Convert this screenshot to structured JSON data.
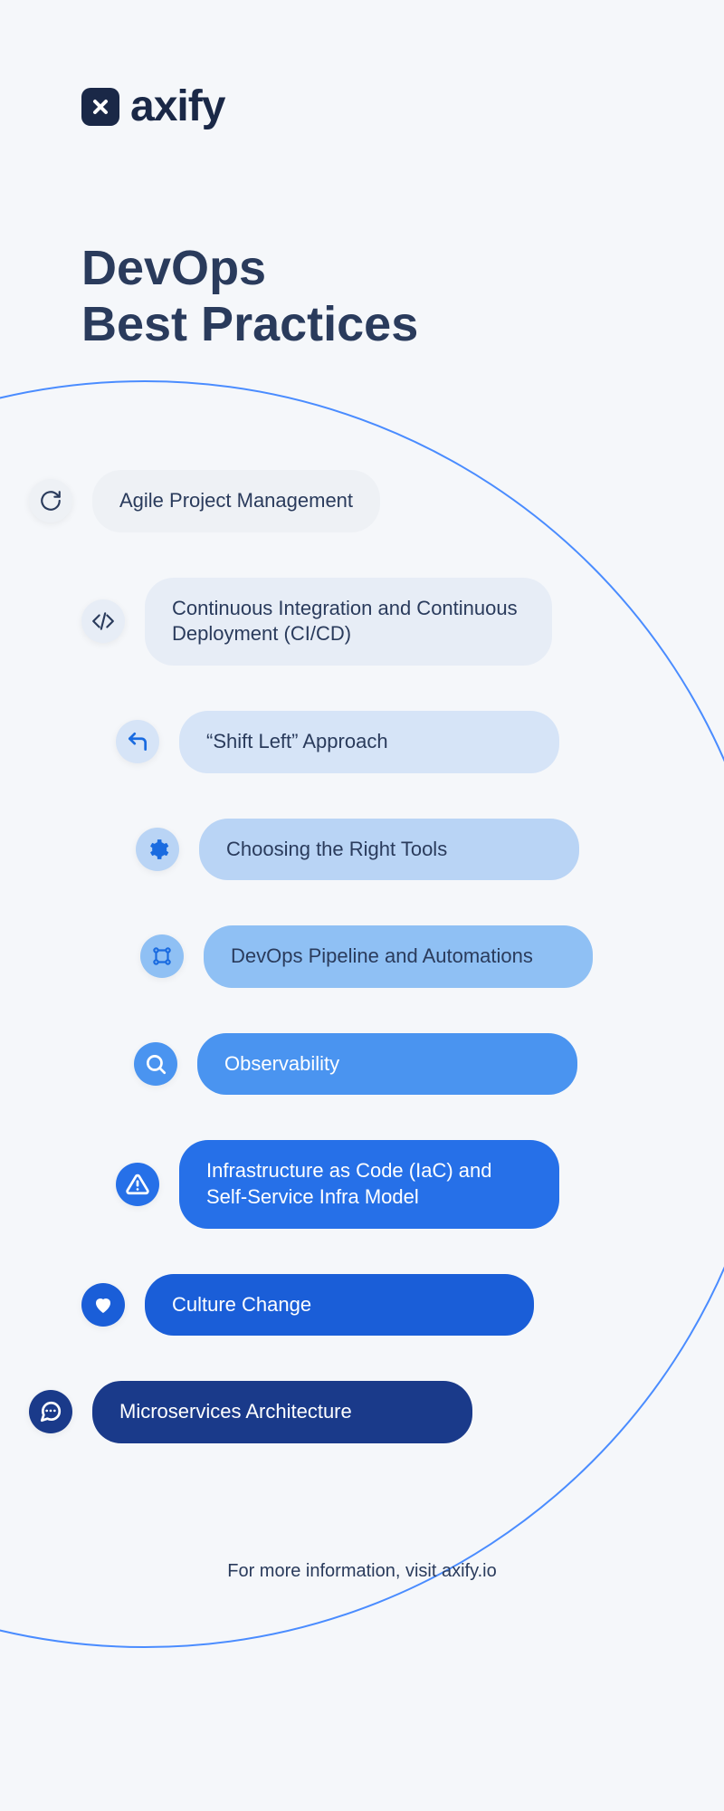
{
  "brand": {
    "name": "axify"
  },
  "title_line1": "DevOps",
  "title_line2": "Best Practices",
  "items": [
    {
      "label": "Agile Project Management",
      "icon_bg": "#eef1f5",
      "pill_bg": "#eef1f5",
      "text_color": "#2a3b5c",
      "icon_color": "#2a3b5c",
      "icon": "cycle"
    },
    {
      "label": "Continuous Integration and Continuous Deployment (CI/CD)",
      "icon_bg": "#e7edf6",
      "pill_bg": "#e7edf6",
      "text_color": "#2a3b5c",
      "icon_color": "#2a3b5c",
      "icon": "code"
    },
    {
      "label": "“Shift Left” Approach",
      "icon_bg": "#d6e4f7",
      "pill_bg": "#d6e4f7",
      "text_color": "#2a3b5c",
      "icon_color": "#1a6be0",
      "icon": "arrow-left"
    },
    {
      "label": "Choosing the Right Tools",
      "icon_bg": "#b9d4f5",
      "pill_bg": "#b9d4f5",
      "text_color": "#2a3b5c",
      "icon_color": "#1a6be0",
      "icon": "gear"
    },
    {
      "label": "DevOps Pipeline and Automations",
      "icon_bg": "#8fc0f4",
      "pill_bg": "#8fc0f4",
      "text_color": "#2a3b5c",
      "icon_color": "#1a6be0",
      "icon": "pipeline"
    },
    {
      "label": "Observability",
      "icon_bg": "#4a94f0",
      "pill_bg": "#4a94f0",
      "text_color": "#ffffff",
      "icon_color": "#ffffff",
      "icon": "search"
    },
    {
      "label": "Infrastructure as Code (IaC) and Self-Service Infra Model",
      "icon_bg": "#2670e8",
      "pill_bg": "#2670e8",
      "text_color": "#ffffff",
      "icon_color": "#ffffff",
      "icon": "alert"
    },
    {
      "label": "Culture Change",
      "icon_bg": "#1a5ed8",
      "pill_bg": "#1a5ed8",
      "text_color": "#ffffff",
      "icon_color": "#ffffff",
      "icon": "heart"
    },
    {
      "label": "Microservices Architecture",
      "icon_bg": "#1a3a8a",
      "pill_bg": "#1a3a8a",
      "text_color": "#ffffff",
      "icon_color": "#ffffff",
      "icon": "chat"
    }
  ],
  "footer": "For more information, visit axify.io"
}
